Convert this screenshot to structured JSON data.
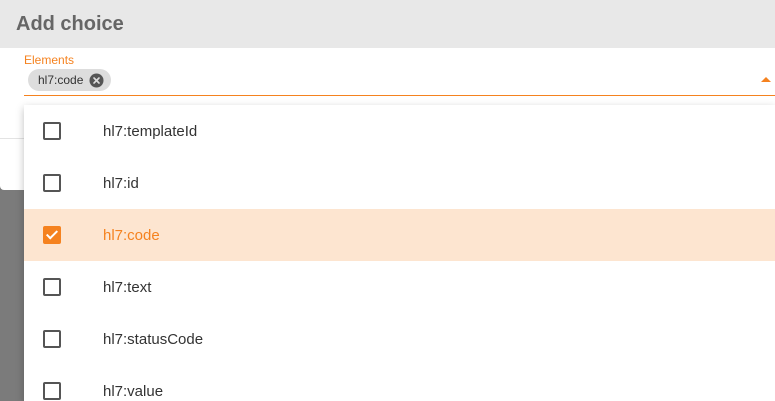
{
  "dialog": {
    "title": "Add choice"
  },
  "field": {
    "label": "Elements",
    "chips": [
      {
        "label": "hl7:code"
      }
    ]
  },
  "menu": {
    "options": [
      {
        "label": "hl7:templateId",
        "checked": false
      },
      {
        "label": "hl7:id",
        "checked": false
      },
      {
        "label": "hl7:code",
        "checked": true
      },
      {
        "label": "hl7:text",
        "checked": false
      },
      {
        "label": "hl7:statusCode",
        "checked": false
      },
      {
        "label": "hl7:value",
        "checked": false
      }
    ]
  },
  "colors": {
    "accent": "#f5821f",
    "selected_background": "#fde5d0",
    "header_background": "#e8e8e8",
    "backdrop": "#7b7b7b"
  },
  "icons": {
    "chip_remove": "close-circle-icon",
    "dropdown": "caret-up-icon",
    "check": "checkmark-icon"
  }
}
